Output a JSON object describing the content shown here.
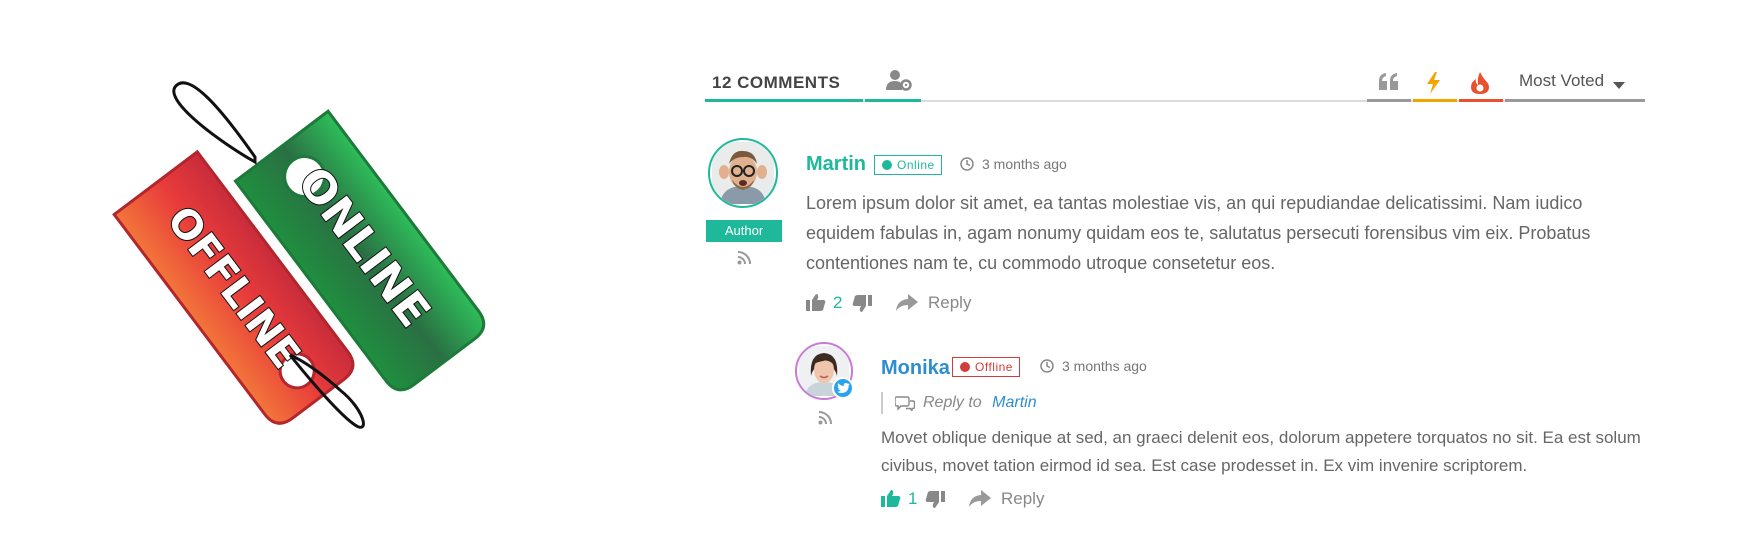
{
  "header": {
    "comments_count_label": "12 COMMENTS",
    "sort_label": "Most Voted"
  },
  "colors": {
    "accent": "#1db99a",
    "online": "#1db99a",
    "offline": "#d33c3c",
    "link": "#2d8ecf",
    "bolt": "#f4a400",
    "fire": "#e8502e"
  },
  "illustration": {
    "tag_online": "ONLINE",
    "tag_offline": "OFFLINE"
  },
  "comments": [
    {
      "author": "Martin",
      "role_label": "Author",
      "status": "Online",
      "time": "3 months ago",
      "text": "Lorem ipsum dolor sit amet, ea tantas molestiae vis, an qui repudiandae delicatissimi. Nam iudico equidem fabulas in, agam nonumy quidam eos te, salutatus persecuti forensibus vim eix. Probatus contentiones nam te, cu commodo utroque consetetur eos.",
      "votes": "2",
      "reply_label": "Reply",
      "icons": [
        "rss-icon",
        "clock-icon",
        "thumbs-up-icon",
        "thumbs-down-icon",
        "reply-arrow-icon"
      ]
    },
    {
      "author": "Monika",
      "status": "Offline",
      "time": "3 months ago",
      "reply_to_label": "Reply to",
      "reply_to_name": "Martin",
      "text": "Movet oblique denique at sed, an graeci delenit eos, dolorum appetere torquatos no sit. Ea est solum civibus, movet tation eirmod id sea. Est case prodesset in. Ex vim invenire scriptorem.",
      "votes": "1",
      "reply_label": "Reply",
      "icons": [
        "twitter-icon",
        "rss-icon",
        "clock-icon",
        "comments-icon",
        "thumbs-up-icon",
        "thumbs-down-icon",
        "reply-arrow-icon"
      ]
    }
  ]
}
